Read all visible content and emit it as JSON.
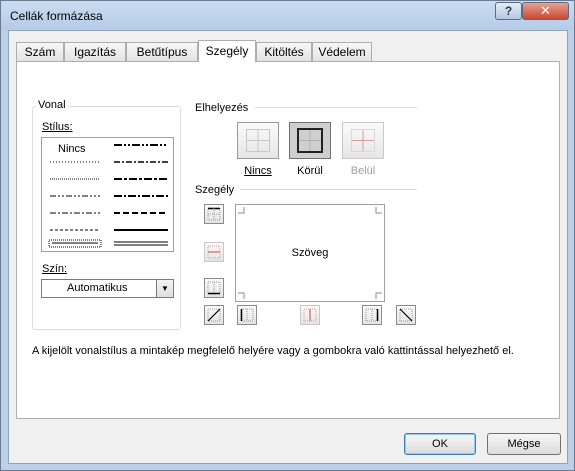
{
  "window": {
    "title": "Cellák formázása"
  },
  "titlebar": {
    "help": "?",
    "close": "✕"
  },
  "tabs": [
    {
      "label": "Szám"
    },
    {
      "label": "Igazítás"
    },
    {
      "label": "Betűtípus"
    },
    {
      "label": "Szegély"
    },
    {
      "label": "Kitöltés"
    },
    {
      "label": "Védelem"
    }
  ],
  "active_tab": "Szegély",
  "vonal": {
    "group_label": "Vonal",
    "style_label": "Stílus:",
    "none_option": "Nincs",
    "color_label": "Szín:",
    "color_value": "Automatikus"
  },
  "elhelyezes": {
    "label": "Elhelyezés",
    "presets": [
      {
        "label": "Nincs"
      },
      {
        "label": "Körül"
      },
      {
        "label": "Belül"
      }
    ]
  },
  "szegely": {
    "label": "Szegély",
    "preview_text": "Szöveg"
  },
  "hint": "A kijelölt vonalstílus a mintakép megfelelő helyére vagy a gombokra való kattintással helyezhető el.",
  "buttons": {
    "ok": "OK",
    "cancel": "Mégse"
  },
  "colors": {
    "title_bar": "#bcd0e8",
    "close_button": "#c74a33",
    "focus": "#3c7fb1"
  }
}
